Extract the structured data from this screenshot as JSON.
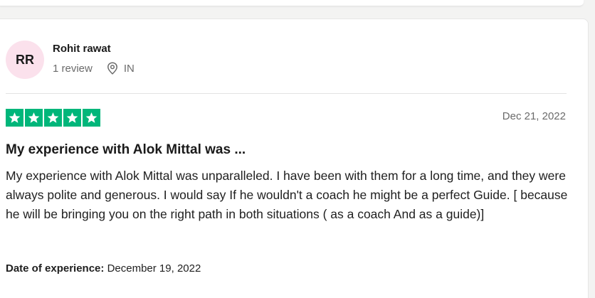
{
  "review": {
    "avatar_initials": "RR",
    "reviewer_name": "Rohit rawat",
    "review_count": "1 review",
    "location": "IN",
    "rating": 5,
    "date": "Dec 21, 2022",
    "title": "My experience with Alok Mittal was ...",
    "body": "My experience with Alok Mittal was unparalleled. I have been with them for a long time, and they were always polite and generous. I would say If he wouldn't a coach he might be a perfect Guide. [ because he will be bringing you on the right path in both situations ( as a coach And as a guide)]",
    "experience_label": "Date of experience:",
    "experience_date": "December 19, 2022"
  },
  "colors": {
    "star_green": "#00b67a",
    "avatar_pink": "#fbe1ec"
  },
  "icons": {
    "location": "location-pin-icon",
    "star": "star-icon"
  }
}
